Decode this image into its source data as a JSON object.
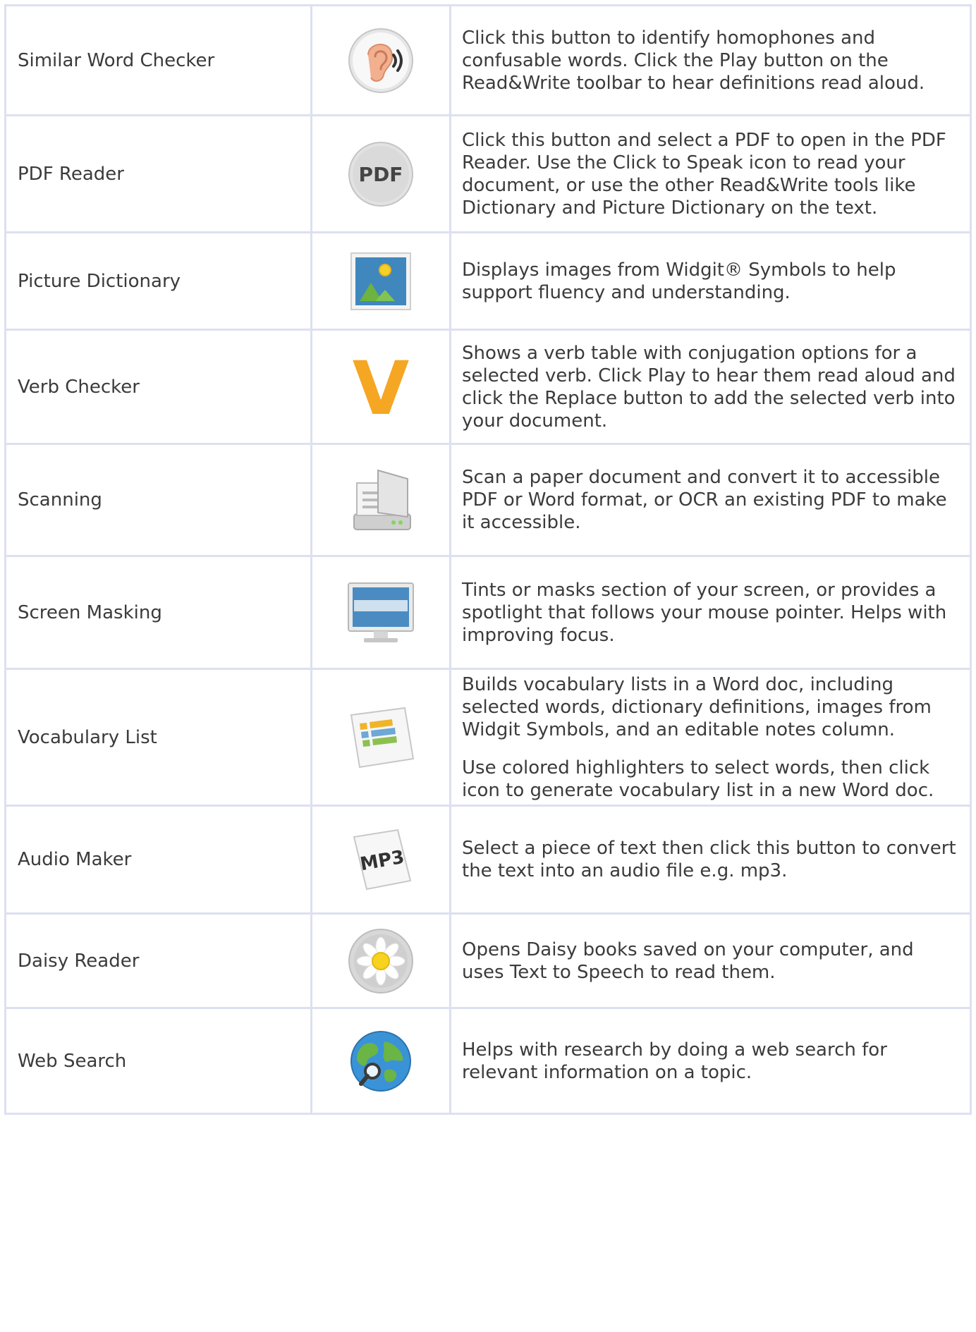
{
  "rows": [
    {
      "name": "Similar Word Checker",
      "icon": "ear-sound-icon",
      "desc": [
        "Click this button to identify homophones and confusable words. Click the Play button on the Read&Write toolbar to hear definitions read aloud."
      ]
    },
    {
      "name": "PDF Reader",
      "icon": "pdf-icon",
      "icon_text": "PDF",
      "desc": [
        "Click this button and select a PDF to open in the PDF Reader. Use the Click to Speak icon to read your document, or use the other Read&Write tools like Dictionary and Picture Dictionary on the text."
      ]
    },
    {
      "name": "Picture Dictionary",
      "icon": "picture-icon",
      "desc": [
        "Displays images from Widgit® Symbols to help support fluency and understanding."
      ]
    },
    {
      "name": "Verb Checker",
      "icon": "letter-v-icon",
      "icon_text": "V",
      "desc": [
        "Shows a verb table with conjugation options for a selected verb. Click Play to hear them read aloud and click the Replace button to add the selected verb into your document."
      ]
    },
    {
      "name": "Scanning",
      "icon": "scanner-icon",
      "desc": [
        "Scan a paper document and convert it to accessible PDF or Word format, or OCR an existing PDF to make it accessible."
      ]
    },
    {
      "name": "Screen Masking",
      "icon": "monitor-icon",
      "desc": [
        "Tints or masks section of your screen, or provides a spotlight that follows your mouse pointer. Helps with improving focus."
      ]
    },
    {
      "name": "Vocabulary List",
      "icon": "vocabulary-list-icon",
      "desc": [
        "Builds vocabulary lists in a Word doc, including selected words, dictionary definitions, images from Widgit Symbols, and an editable notes column.",
        "Use colored highlighters to select words, then click icon to generate vocabulary list in a new Word doc."
      ]
    },
    {
      "name": "Audio Maker",
      "icon": "mp3-file-icon",
      "icon_text": "MP3",
      "desc": [
        "Select a piece of text then click this button to convert the text into an audio file e.g. mp3."
      ]
    },
    {
      "name": "Daisy Reader",
      "icon": "daisy-flower-icon",
      "desc": [
        "Opens Daisy books saved on your computer, and uses Text to Speech to read them."
      ]
    },
    {
      "name": "Web Search",
      "icon": "globe-search-icon",
      "desc": [
        "Helps with research by doing a web search for relevant information on a topic."
      ]
    }
  ]
}
